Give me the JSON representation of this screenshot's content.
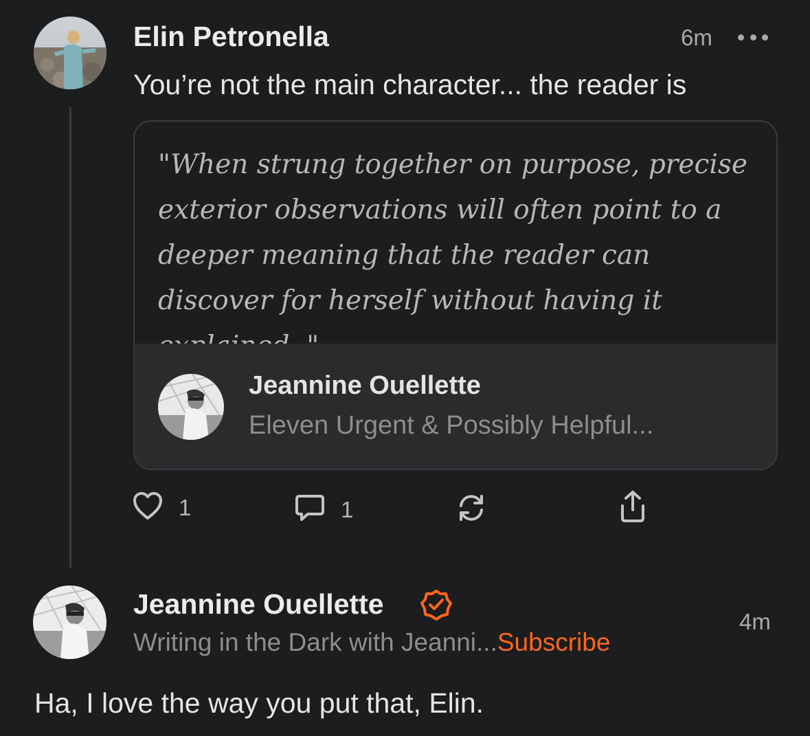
{
  "post": {
    "author": "Elin Petronella",
    "time": "6m",
    "text": "You’re not the main character... the reader is",
    "quote": {
      "text": "\"When strung together on purpose, precise exterior observations will often point to a deeper meaning that the reader can discover for herself without having it explained. \"",
      "source_author": "Jeannine Ouellette",
      "source_title": "Eleven Urgent & Possibly Helpful..."
    },
    "actions": {
      "likes": "1",
      "comments": "1"
    }
  },
  "reply": {
    "author": "Jeannine Ouellette",
    "publication": "Writing in the Dark with Jeanni...",
    "subscribe_label": "Subscribe",
    "time": "4m",
    "text": "Ha, I love the way you put that, Elin."
  },
  "colors": {
    "background": "#1c1d1f",
    "accent": "#ff6719",
    "quote_source_bg": "#2a2b2d"
  },
  "icons": [
    "more-icon",
    "heart-icon",
    "comment-icon",
    "restack-icon",
    "share-icon",
    "verified-badge-icon"
  ]
}
